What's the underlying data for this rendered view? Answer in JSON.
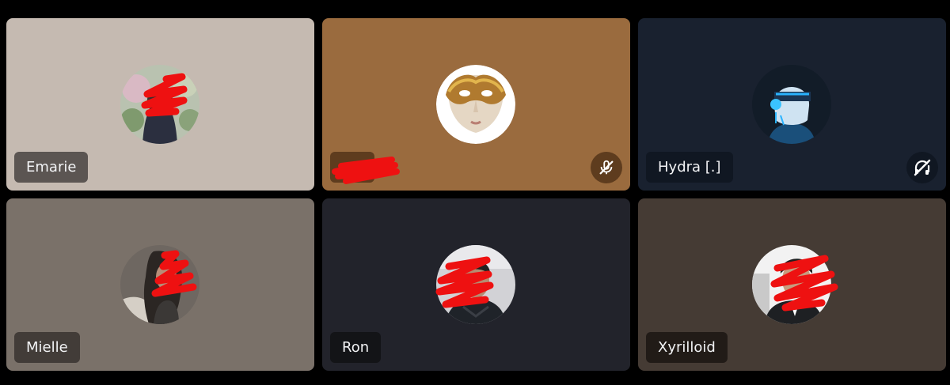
{
  "participants": [
    {
      "name": "Emarie",
      "bg": "#c5bab1",
      "plate": "#5b5552",
      "icon": null
    },
    {
      "name": "",
      "bg": "#9a6b3e",
      "plate": "#5e3c1e",
      "icon": "mic-off-icon"
    },
    {
      "name": "Hydra [.]",
      "bg": "#19212f",
      "plate": "#101722",
      "icon": "deafened-icon"
    },
    {
      "name": "Mielle",
      "bg": "#7a7169",
      "plate": "#423c38",
      "icon": null
    },
    {
      "name": "Ron",
      "bg": "#22232b",
      "plate": "#131417",
      "icon": null
    },
    {
      "name": "Xyrilloid",
      "bg": "#453b34",
      "plate": "#211b17",
      "icon": null
    }
  ]
}
